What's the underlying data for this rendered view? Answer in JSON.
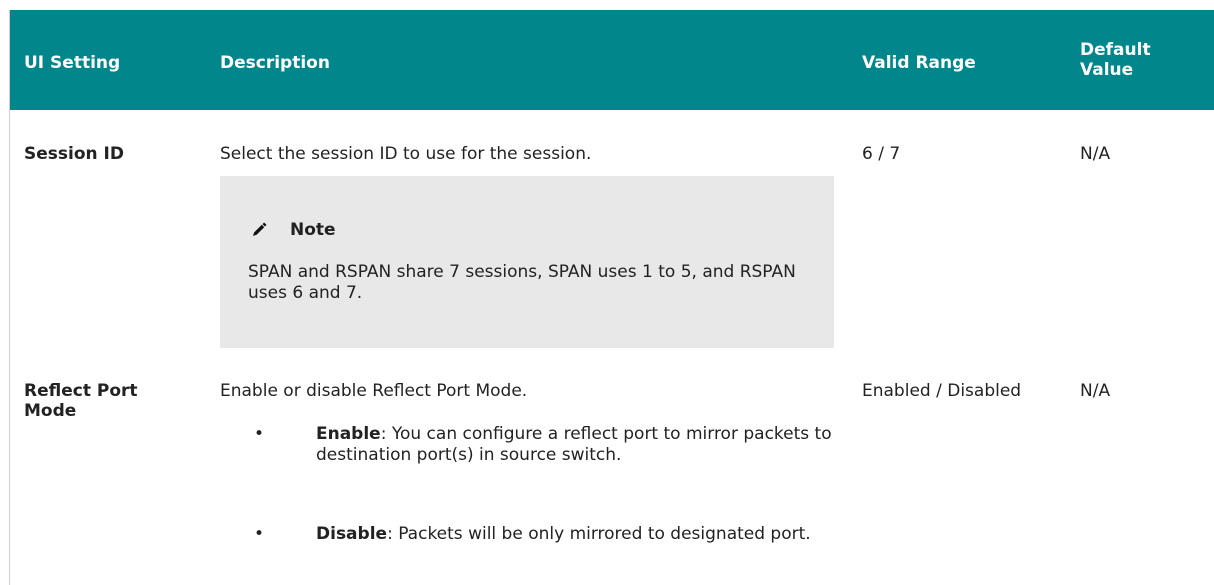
{
  "header": {
    "ui_setting": "UI Setting",
    "description": "Description",
    "valid_range": "Valid Range",
    "default_value": "Default Value"
  },
  "rows": [
    {
      "setting": "Session ID",
      "description": "Select the session ID to use for the session.",
      "valid_range": "6 / 7",
      "default_value": "N/A",
      "note": {
        "icon": "pencil-icon",
        "title": "Note",
        "text": "SPAN and RSPAN share 7 sessions, SPAN uses 1 to 5, and RSPAN uses 6 and 7."
      }
    },
    {
      "setting": "Reflect Port Mode",
      "description": "Enable or disable Reflect Port Mode.",
      "valid_range": "Enabled / Disabled",
      "default_value": "N/A",
      "bullets": [
        {
          "label": "Enable",
          "text": ": You can configure a reflect port to mirror packets to destination port(s) in source switch."
        },
        {
          "label": "Disable",
          "text": ": Packets will be only mirrored to designated port."
        }
      ]
    }
  ],
  "colors": {
    "header_background": "#00868b",
    "header_text": "#ffffff",
    "note_background": "#e8e8e8"
  }
}
